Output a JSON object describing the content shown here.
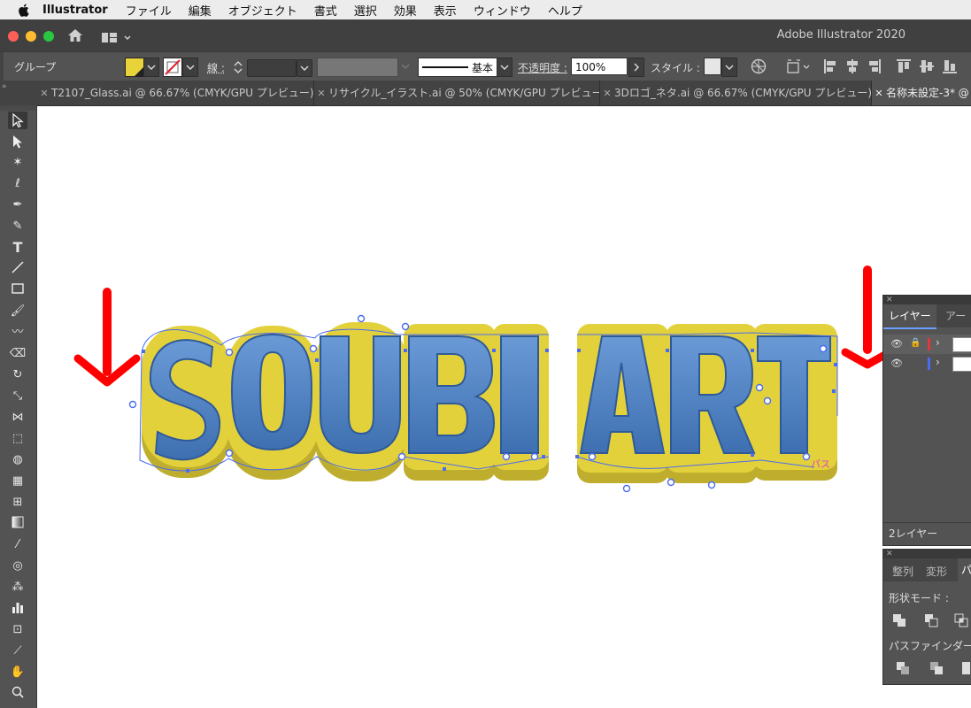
{
  "menubar": {
    "app_name": "Illustrator",
    "items": [
      "ファイル",
      "編集",
      "オブジェクト",
      "書式",
      "選択",
      "効果",
      "表示",
      "ウィンドウ",
      "ヘルプ"
    ]
  },
  "window": {
    "title": "Adobe Illustrator 2020"
  },
  "control_bar": {
    "selection_label": "グループ",
    "stroke_label": "線 :",
    "stroke_profile": "基本",
    "opacity_label": "不透明度 :",
    "opacity_value": "100%",
    "style_label": "スタイル :"
  },
  "tabs": [
    {
      "label": "T2107_Glass.ai @ 66.67% (CMYK/GPU プレビュー)",
      "active": false
    },
    {
      "label": "リサイクル_イラスト.ai @ 50% (CMYK/GPU プレビュー)",
      "active": false
    },
    {
      "label": "3Dロゴ_ネタ.ai @ 66.67% (CMYK/GPU プレビュー)",
      "active": false
    },
    {
      "label": "名称未設定-3* @",
      "active": true
    }
  ],
  "tools": [
    "selection-tool",
    "direct-selection-tool",
    "magic-wand-tool",
    "lasso-tool",
    "pen-tool",
    "curvature-tool",
    "type-tool",
    "line-tool",
    "rectangle-tool",
    "paintbrush-tool",
    "shaper-tool",
    "eraser-tool",
    "rotate-tool",
    "scale-tool",
    "width-tool",
    "free-transform-tool",
    "shape-builder-tool",
    "perspective-grid-tool",
    "mesh-tool",
    "gradient-tool",
    "eyedropper-tool",
    "blend-tool",
    "symbol-sprayer-tool",
    "column-graph-tool",
    "artboard-tool",
    "slice-tool",
    "hand-tool",
    "zoom-tool"
  ],
  "artwork": {
    "text": "SOUBI ART",
    "label_fragment": "パス"
  },
  "layers_panel": {
    "tab_layers": "レイヤー",
    "tab_artboards": "アート",
    "layer_count": "2レイヤー",
    "layer_colors": [
      "#e0363c",
      "#4a6cf0"
    ]
  },
  "pathfinder_panel": {
    "tab_align": "整列",
    "tab_transform": "変形",
    "tab_pathfinder": "パ",
    "shape_modes_label": "形状モード :",
    "pathfinders_label": "パスファインダー"
  },
  "colors": {
    "fill": "#e8d43a",
    "text_fill": "#4a7fc4",
    "text_extrude": "#d8c53a",
    "selection": "#4a6cf0",
    "annotation_arrow": "#ff0000"
  }
}
